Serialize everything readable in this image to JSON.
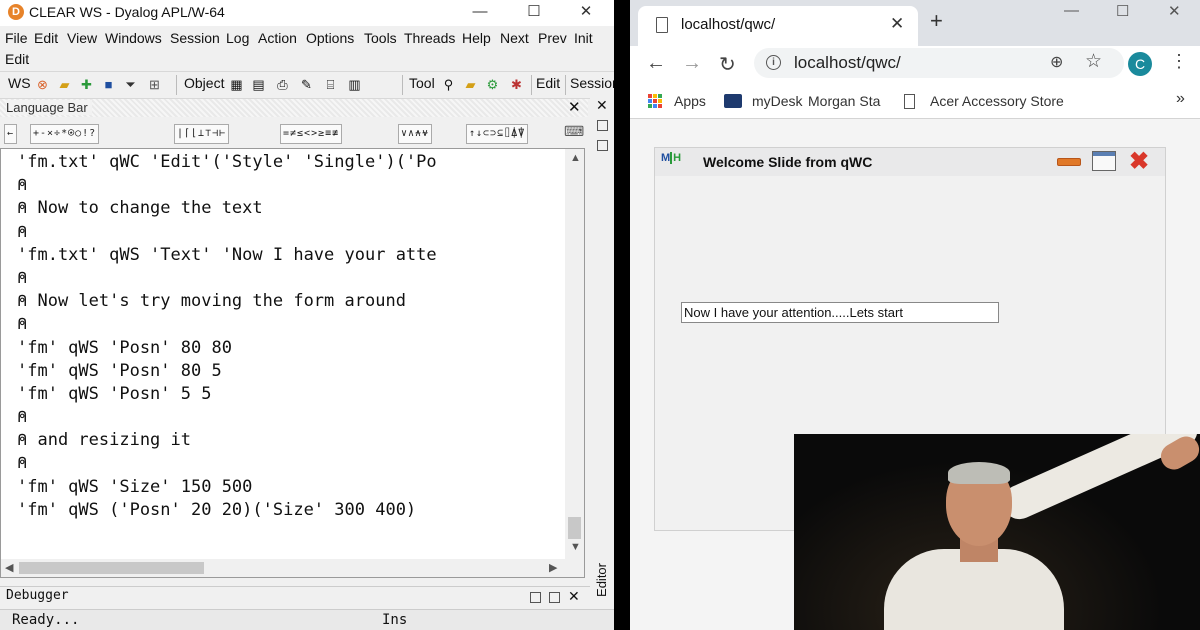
{
  "dyalog": {
    "title": "CLEAR WS - Dyalog APL/W-64",
    "menu": [
      "File",
      "Edit",
      "View",
      "Windows",
      "Session",
      "Log",
      "Action",
      "Options",
      "Tools",
      "Threads",
      "Help",
      "Next",
      "Prev",
      "Init",
      "Edit"
    ],
    "toolbar": {
      "ws_label": "WS",
      "object_label": "Object",
      "tool_label": "Tool",
      "edit_label": "Edit",
      "session_label": "Session"
    },
    "language_bar_title": "Language Bar",
    "language_bar_groups": [
      "←",
      "+-×÷*⍟○!?",
      "|⌈⌊⊥⊤⊣⊢",
      "=≠≤<>≥≡≢",
      "∨∧⍲⍱",
      "↑↓⊂⊃⊆⌷⍋⍒"
    ],
    "session_lines": [
      "'fm.txt' qWC 'Edit'('Style' 'Single')('Po",
      "⍝",
      "⍝ Now to change the text",
      "⍝",
      "'fm.txt' qWS 'Text' 'Now I have your atte",
      "⍝",
      "⍝ Now let's try moving the form around",
      "⍝",
      "'fm' qWS 'Posn' 80 80",
      "'fm' qWS 'Posn' 80 5",
      "'fm' qWS 'Posn' 5 5",
      "⍝",
      "⍝ and resizing it",
      "⍝",
      "'fm' qWS 'Size' 150 500",
      "'fm' qWS ('Posn' 20 20)('Size' 300 400)"
    ],
    "debugger_label": "Debugger",
    "editor_label": "Editor",
    "status_left": "Ready...",
    "status_ins": "Ins"
  },
  "browser": {
    "tab_title": "localhost/qwc/",
    "url": "localhost/qwc/",
    "avatar_letter": "C",
    "bookmarks": [
      "Apps",
      "myDesk",
      "Morgan Sta",
      "Acer Accessory Store"
    ],
    "more": "»"
  },
  "qwc_window": {
    "logo": "MH",
    "title": "Welcome Slide from qWC",
    "text_field_value": "Now I have your attention.....Lets start"
  },
  "colors": {
    "dyalog_logo": "#e7832a",
    "avatar": "#1a8a9c",
    "min_button": "#e07828",
    "close_button": "#d9372a"
  }
}
